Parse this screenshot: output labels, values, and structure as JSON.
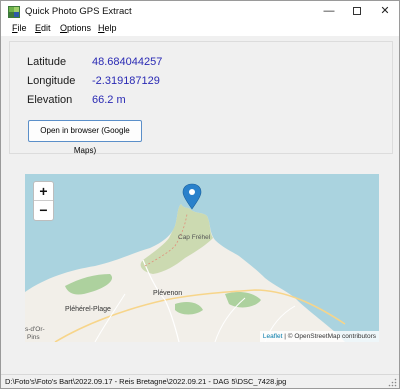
{
  "window": {
    "title": "Quick Photo GPS Extract",
    "min_glyph": "—",
    "close_glyph": "✕"
  },
  "menu": {
    "file_key": "F",
    "file_rest": "ile",
    "edit_key": "E",
    "edit_rest": "dit",
    "options_key": "O",
    "options_rest": "ptions",
    "help_key": "H",
    "help_rest": "elp"
  },
  "info": {
    "latitude_label": "Latitude",
    "latitude_value": "48.684044257",
    "longitude_label": "Longitude",
    "longitude_value": "-2.319187129",
    "elevation_label": "Elevation",
    "elevation_value": "66.2 m",
    "open_button_label": "Open in browser (Google Maps)"
  },
  "map": {
    "zoom_in": "+",
    "zoom_out": "−",
    "attribution_leaflet": "Leaflet",
    "attribution_sep": " | © ",
    "attribution_osm": "OpenStreetMap contributors",
    "place_plevenon": "Plévenon",
    "place_pleherel": "Pléhérel-Plage",
    "place_cap": "Cap Fréhel",
    "place_dor": "s-d'Or-",
    "place_pins": "Pins",
    "colors": {
      "sea": "#aad3df",
      "land": "#f2efe9",
      "heath": "#c8d7ab",
      "wood": "#add19e",
      "marker": "#2a81cb"
    }
  },
  "status": {
    "path": "D:\\Foto's\\Foto's Bart\\2022.09.17 - Reis Bretagne\\2022.09.21 - DAG 5\\DSC_7428.jpg"
  }
}
